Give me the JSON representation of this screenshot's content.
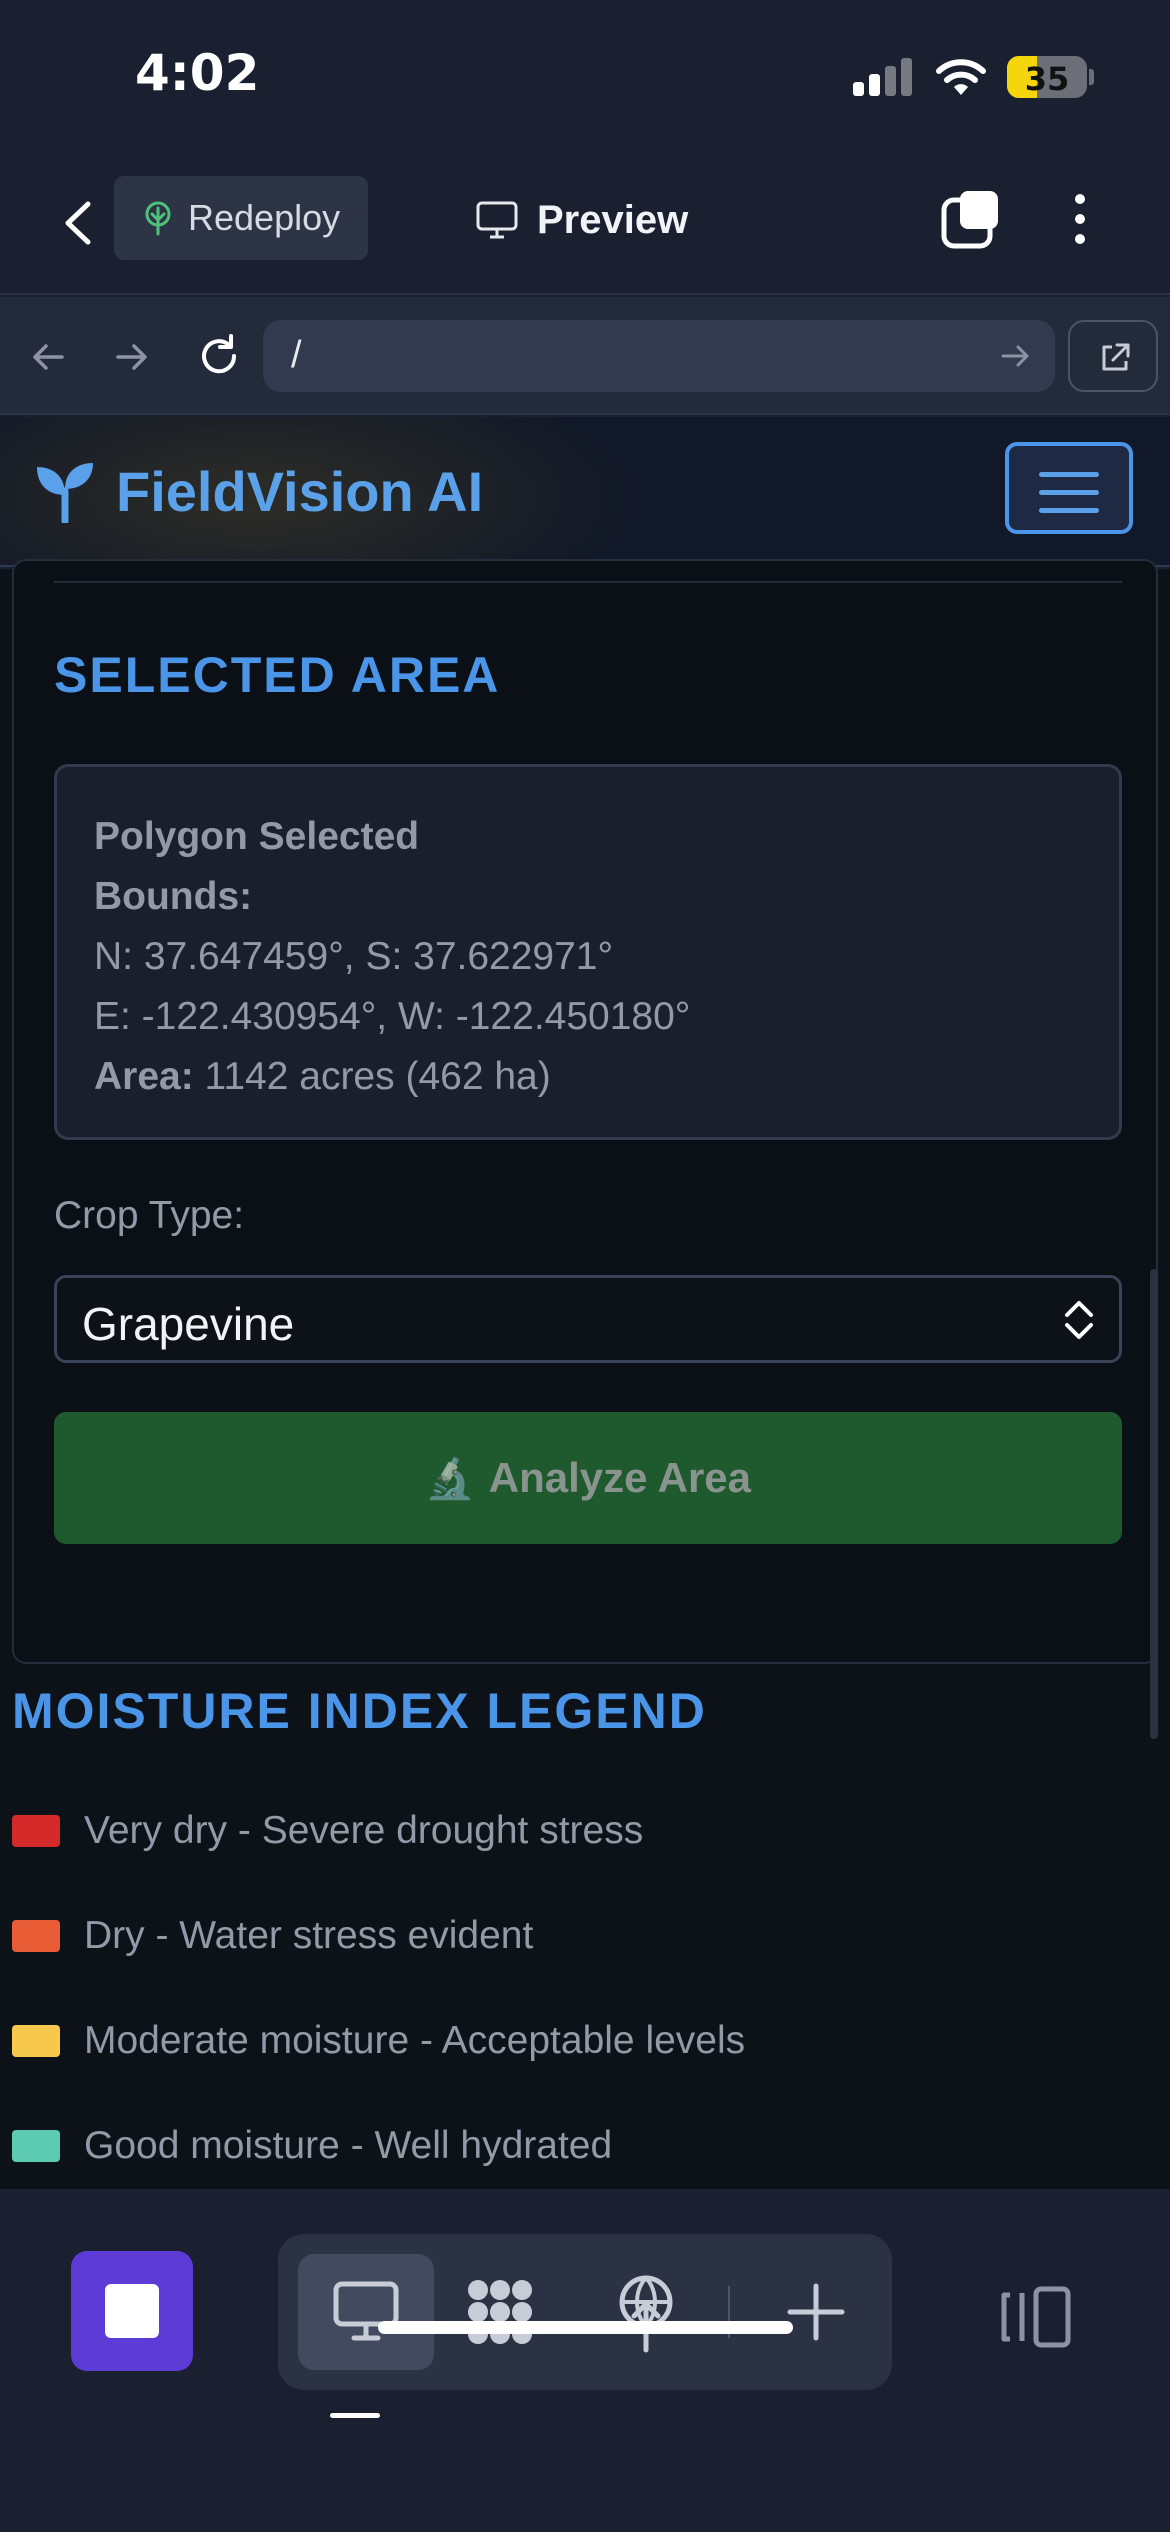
{
  "status_bar": {
    "time": "4:02",
    "battery": "35"
  },
  "toolbar": {
    "redeploy_label": "Redeploy",
    "preview_label": "Preview"
  },
  "browser": {
    "url": "/"
  },
  "site": {
    "brand": "FieldVision AI"
  },
  "selected_area": {
    "title": "SELECTED AREA",
    "polygon_label": "Polygon Selected",
    "bounds_label": "Bounds:",
    "ns_text": "N: 37.647459°, S: 37.622971°",
    "ew_text": "E: -122.430954°, W: -122.450180°",
    "area_label": "Area:",
    "area_value": " 1142 acres (462 ha)"
  },
  "crop": {
    "label": "Crop Type:",
    "selected": "Grapevine"
  },
  "analyze": {
    "icon": "🔬",
    "label": "Analyze Area"
  },
  "legend": {
    "title": "MOISTURE INDEX LEGEND",
    "items": [
      {
        "color": "#d42a2a",
        "text": "Very dry - Severe drought stress"
      },
      {
        "color": "#e85c36",
        "text": "Dry - Water stress evident"
      },
      {
        "color": "#f6c94c",
        "text": "Moderate moisture - Acceptable levels"
      },
      {
        "color": "#5ccbb1",
        "text": "Good moisture - Well hydrated"
      }
    ]
  },
  "colors": {
    "accent": "#4a95e8",
    "analyze_bg": "#1f5a2e",
    "stop_button": "#5c3bd6"
  }
}
